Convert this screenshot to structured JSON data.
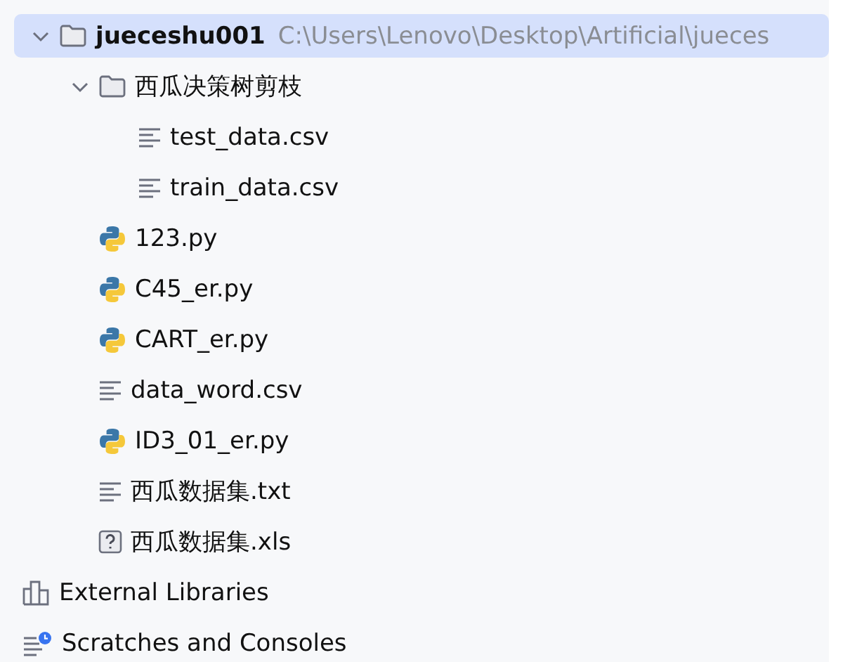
{
  "tree": [
    {
      "kind": "folder",
      "name": "jueceshu001",
      "path": "C:\\Users\\Lenovo\\Desktop\\Artificial\\jueces",
      "selected": true,
      "expanded": true,
      "children": [
        {
          "kind": "folder",
          "name": "西瓜决策树剪枝",
          "selected": false,
          "expanded": true,
          "children": [
            {
              "kind": "text",
              "name": "test_data.csv",
              "selected": false
            },
            {
              "kind": "text",
              "name": "train_data.csv",
              "selected": false
            }
          ]
        },
        {
          "kind": "python",
          "name": "123.py",
          "selected": false
        },
        {
          "kind": "python",
          "name": "C45_er.py",
          "selected": false
        },
        {
          "kind": "python",
          "name": "CART_er.py",
          "selected": false
        },
        {
          "kind": "text",
          "name": "data_word.csv",
          "selected": false
        },
        {
          "kind": "python",
          "name": "ID3_01_er.py",
          "selected": false
        },
        {
          "kind": "text",
          "name": "西瓜数据集.txt",
          "selected": false
        },
        {
          "kind": "unknown",
          "name": "西瓜数据集.xls",
          "selected": false
        }
      ]
    },
    {
      "kind": "libraries",
      "name": "External Libraries",
      "selected": false
    },
    {
      "kind": "scratches",
      "name": "Scratches and Consoles",
      "selected": false
    }
  ]
}
